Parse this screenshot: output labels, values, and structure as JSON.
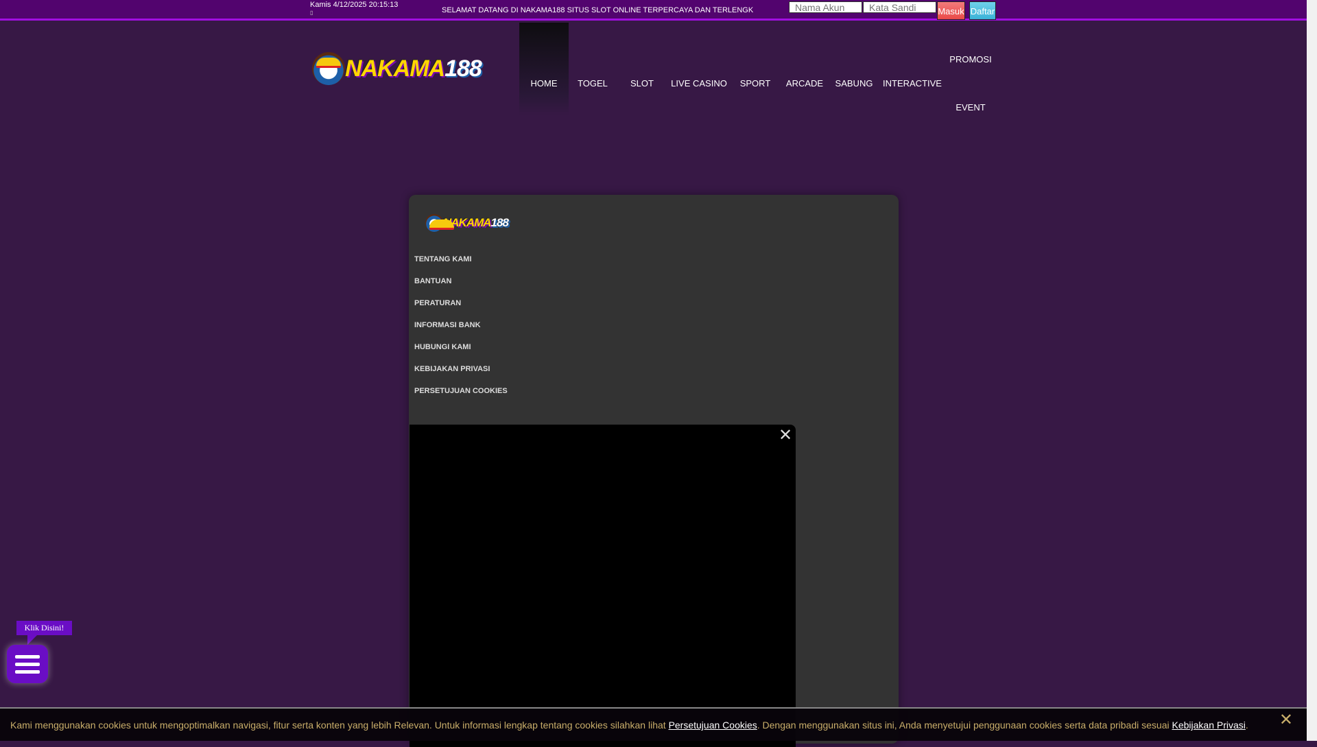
{
  "topbar": {
    "datetime": "Kamis 4/12/2025 20:15:13",
    "marquee": "SELAMAT DATANG DI NAKAMA188 SITUS SLOT ONLINE TERPERCAYA DAN TERLENGK",
    "username_placeholder": "Nama Akun",
    "password_placeholder": "Kata Sandi",
    "login_label": "Masuk",
    "register_label": "Daftar"
  },
  "logo": {
    "text_a": "NAKAMA",
    "text_b": "188"
  },
  "nav": [
    "HOME",
    "TOGEL",
    "SLOT",
    "LIVE CASINO",
    "SPORT",
    "ARCADE",
    "SABUNG",
    "INTERACTIVE",
    "PROMOSI",
    "EVENT"
  ],
  "panel": {
    "menu": [
      "TENTANG KAMI",
      "BANTUAN",
      "PERATURAN",
      "INFORMASI BANK",
      "HUBUNGI KAMI",
      "KEBIJAKAN PRIVASI",
      "PERSETUJUAN COOKIES"
    ]
  },
  "floating": {
    "tooltip": "Klik Disini!"
  },
  "cookie": {
    "text1": "Kami menggunakan cookies untuk mengoptimalkan navigasi, fitur serta konten yang lebih Relevan. Untuk informasi lengkap tentang cookies silahkan lihat ",
    "link1": "Persetujuan Cookies",
    "text2": ". Dengan menggunakan situs ini, Anda menyetujui penggunaan cookies serta data pribadi sesuai ",
    "link2": "Kebijakan Privasi",
    "text3": "."
  },
  "colors": {
    "topbar": "#52046e",
    "background": "#371845",
    "accent": "#6a0dc5",
    "login": "#ef5350",
    "register": "#4fc3e0"
  }
}
